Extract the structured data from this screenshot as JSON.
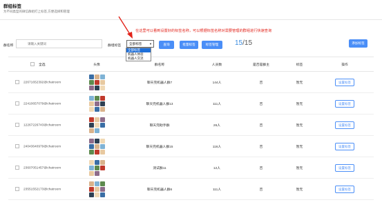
{
  "header": {
    "title": "群组标签",
    "subtitle": "为不同类型的微信群组打上标签,方便选择和管理"
  },
  "annotation": "在这里可以看到设置好的标签名称，可以根据标签名称对需要管理的群组进行快速查询",
  "filters": {
    "group_name_label": "群名称",
    "search_placeholder": "请输入关键词",
    "tag_label": "群组标签",
    "tag_selected": "全部标签",
    "tag_options": [
      "全部标签",
      "机器人体验",
      "机器人交流"
    ]
  },
  "toolbar": {
    "query_label": "查询",
    "batch_tag_label": "批量标签",
    "tag_manage_label": "标签管理",
    "add_tag_label": "添加标签",
    "count_current": "15",
    "count_total": "/15"
  },
  "table": {
    "headers": [
      "全选",
      "头像",
      "群名称",
      "人员数",
      "是否是群主",
      "标签",
      "操作"
    ],
    "rows": [
      {
        "id": "22671652392@chatroom",
        "name": "聊天完机器人群7",
        "members": "144人",
        "is_owner": "否",
        "tag": "暂无",
        "action": "设置标签"
      },
      {
        "id": "22410657079@chatroom",
        "name": "聊天完机器人群13",
        "members": "111人",
        "is_owner": "否",
        "tag": "暂无",
        "action": "设置标签"
      },
      {
        "id": "12267226743@chatroom",
        "name": "聊天完助手群",
        "members": "26人",
        "is_owner": "否",
        "tag": "暂无",
        "action": "设置标签"
      },
      {
        "id": "24043640979@chatroom",
        "name": "聊天完机器人群15",
        "members": "116人",
        "is_owner": "否",
        "tag": "暂无",
        "action": "设置标签"
      },
      {
        "id": "23607051457@chatroom",
        "name": "测试群11",
        "members": "12人",
        "is_owner": "否",
        "tag": "暂无",
        "action": "设置标签"
      },
      {
        "id": "23551552173@chatroom",
        "name": "聊天完机器人群6",
        "members": "111人",
        "is_owner": "否",
        "tag": "暂无",
        "action": "设置标签"
      }
    ]
  },
  "colors": {
    "accent": "#4a8ef7",
    "annotation": "#e2231a",
    "dropdown_selected": "#1e6fd9"
  }
}
